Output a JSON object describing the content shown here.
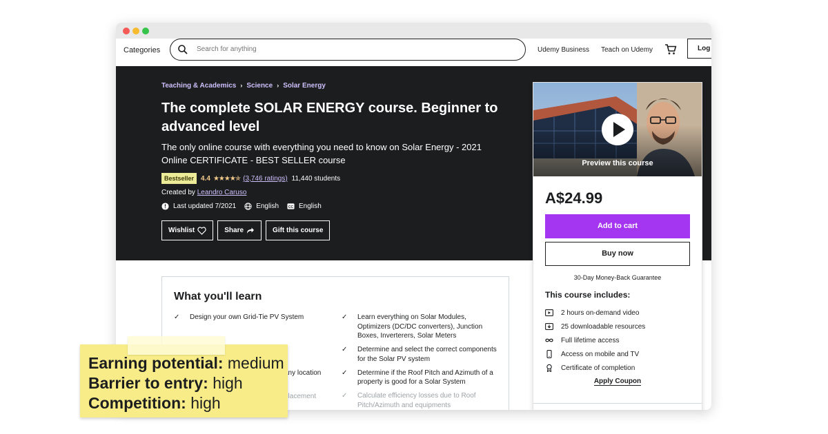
{
  "nav": {
    "categories": "Categories",
    "search_placeholder": "Search for anything",
    "business": "Udemy Business",
    "teach": "Teach on Udemy",
    "login": "Log"
  },
  "course": {
    "breadcrumb": [
      "Teaching & Academics",
      "Science",
      "Solar Energy"
    ],
    "title": "The complete SOLAR ENERGY course. Beginner to advanced level",
    "subtitle": "The only online course with everything you need to know on Solar Energy - 2021 Online CERTIFICATE - BEST SELLER course",
    "badge": "Bestseller",
    "rating": "4.4",
    "stars": "★★★★✯",
    "ratings_count": "(3,746 ratings)",
    "students": "11,440 students",
    "created_by_label": "Created by",
    "author": "Leandro Caruso",
    "last_updated": "Last updated 7/2021",
    "language": "English",
    "captions": "English",
    "buttons": {
      "wishlist": "Wishlist",
      "share": "Share",
      "gift": "Gift this course"
    }
  },
  "sidebar": {
    "preview_label": "Preview this course",
    "price": "A$24.99",
    "add_to_cart": "Add to cart",
    "buy_now": "Buy now",
    "guarantee": "30-Day Money-Back Guarantee",
    "includes_title": "This course includes:",
    "includes": [
      {
        "icon": "video-icon",
        "text": "2 hours on-demand video"
      },
      {
        "icon": "download-icon",
        "text": "25 downloadable resources"
      },
      {
        "icon": "infinity-icon",
        "text": "Full lifetime access"
      },
      {
        "icon": "mobile-icon",
        "text": "Access on mobile and TV"
      },
      {
        "icon": "certificate-icon",
        "text": "Certificate of completion"
      }
    ],
    "apply_coupon": "Apply Coupon"
  },
  "learn": {
    "title": "What you'll learn",
    "left": [
      "Design your own Grid-Tie PV System",
      "",
      "",
      "any location",
      "placement"
    ],
    "right": [
      "Learn everything on Solar Modules, Optimizers (DC/DC converters), Junction Boxes, Inverterers, Solar Meters",
      "Determine and select the correct components for the Solar PV system",
      "Determine if the Roof Pitch and Azimuth of a property is good for a Solar System",
      "Calculate efficiency losses due to Roof Pitch/Azimuth and equipments"
    ]
  },
  "note": {
    "earning_label": "Earning potential:",
    "earning_value": "medium",
    "barrier_label": "Barrier to entry:",
    "barrier_value": "high",
    "competition_label": "Competition:",
    "competition_value": "high"
  }
}
